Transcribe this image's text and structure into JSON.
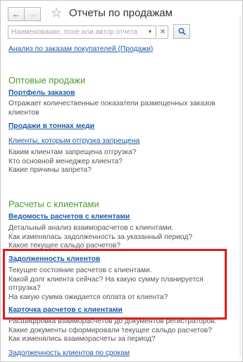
{
  "header": {
    "title": "Отчеты по продажам"
  },
  "search": {
    "placeholder": "Наименование, поле или автор отчета"
  },
  "top_link": "Анализ по заказам покупателей (Продажи)",
  "sections": {
    "wholesale": {
      "title": "Оптовые продажи",
      "portfolio": {
        "label": "Портфель заказов",
        "desc": [
          "Отражает количественные показатели размещенных заказов",
          "клиентов"
        ]
      },
      "tons": {
        "label": "Продажи в тоннах меди"
      },
      "blocked": {
        "label": "Клиенты, которым отгрузка запрещена",
        "desc": [
          "Каким клиентам запрещена отгрузка?",
          "Кто основной менеджер клиента?",
          "Какие причины запрета?"
        ]
      }
    },
    "settlements": {
      "title": "Расчеты с клиентами",
      "ledger": {
        "label": "Ведомость расчетов с клиентами",
        "desc": [
          "Детальный анализ взаиморасчетов с клиентами.",
          "Как изменялась задолженность за указанный период?",
          "Какое текущее сальдо расчетов?"
        ]
      },
      "debt": {
        "label": "Задолженность клиентов",
        "desc": [
          "Текущее состояние расчетов с клиентами.",
          "Какой долг клиента сейчас? На какую сумму планируется",
          "отгрузка?",
          "На какую сумма ожидается оплата от клиента?"
        ]
      },
      "card": {
        "label": "Карточка расчетов с клиентами",
        "desc": [
          "Расшифровка взаиморасчетов до документов регистраторов.",
          "Какие документы сформировали текущее сальдо расчетов?",
          "Как изменялись взаиморасчеты за период?"
        ]
      },
      "terms": {
        "label": "Задолженность клиентов по срокам"
      }
    }
  },
  "colors": {
    "link": "#1a5aa8",
    "section": "#4e9a2e",
    "highlight": "#e41a1a"
  }
}
